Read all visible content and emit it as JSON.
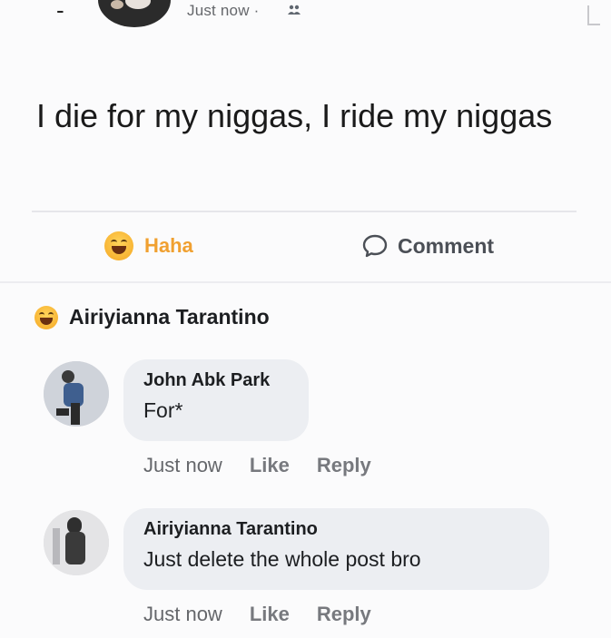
{
  "post": {
    "time": "Just now ·",
    "text": "I die for my niggas, I ride my niggas"
  },
  "actions": {
    "haha_label": "Haha",
    "comment_label": "Comment"
  },
  "reaction": {
    "reactor_name": "Airiyianna Tarantino"
  },
  "comments": [
    {
      "author": "John Abk Park",
      "text": "For*",
      "time": "Just now",
      "like_label": "Like",
      "reply_label": "Reply"
    },
    {
      "author": "Airiyianna Tarantino",
      "text": "Just delete the whole post bro",
      "time": "Just now",
      "like_label": "Like",
      "reply_label": "Reply"
    }
  ],
  "colors": {
    "haha": "#f0a030",
    "secondary_text": "#65676b",
    "bubble": "#eceef2"
  }
}
